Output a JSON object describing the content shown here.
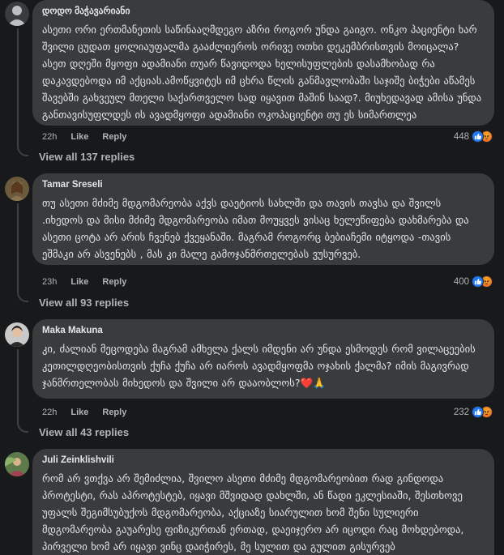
{
  "comments": [
    {
      "author": "დოდო მაჭავარიანი",
      "text": "ასეთი ორი ერთმანეთის საწინააღმდეგო აზრი როგორ უნდა გაიგო. ონკო პაციენტი ხარ შვილი ცუდათ ყოლიაუფალმა გააძლიეროს ორივე ოთხი დეკემბრისთვის მოიცალა? ასეთ დღეში მყოფი ადამიანი თუარ წავიდოდა ხელისუფლების დასამხობად რა დაკავდებოდა იმ აქციას.ამოწყვიტეს იმ ცხრა წლის განმავლობაში საჯიშე ბიჭები აწამეს შავებში გახვეულ მთელი საქართველო სად იყავით მაშინ საად?. მიუხედავად ამისა უნდა განთავისუფლდეს ის ავადმყოფი ადამიანი ოკოპაციენტი თუ ეს სიმართლეა",
      "time": "22h",
      "like": "Like",
      "reply": "Reply",
      "reaction_count": "448",
      "view_replies": "View all 137 replies"
    },
    {
      "author": "Tamar Sreseli",
      "text": "თუ ასეთი მძიმე მდგომარეობა აქვს დაეტიოს სახლში და თავის თავსა და შვილს .იხედოს და მისი მძიმე მდგომარეობა იმათ მოუყვეს ვისაც ხელეწიფება დახმარება და ასეთი ცოტა არ არის ჩვენებ ქვეყანაში. მაგრამ როგორც ბებიაჩემი იტყოდა -თავის ეშმაკი არ ასვენებს , მას კი მალე გამოჯანმრთელებას ვუსურვებ.",
      "time": "23h",
      "like": "Like",
      "reply": "Reply",
      "reaction_count": "400",
      "view_replies": "View all 93 replies"
    },
    {
      "author": "Maka Makuna",
      "text": "კი, ძალიან მეცოდება მაგრამ ამხელა ქალს იმდენი არ უნდა ესმოდეს რომ ვილაცეების კეთილდღეობისთვის ქუჩა ქუჩა არ იაროს ავადმყოფმა ოჯახის ქალმა? იმის მაგივრად ჯანმრთელობას მიხედოს და შვილი არ დააობლოს?",
      "emoji": "❤️🙏",
      "time": "22h",
      "like": "Like",
      "reply": "Reply",
      "reaction_count": "232",
      "view_replies": "View all 43 replies"
    },
    {
      "author": "Juli Zeinklishvili",
      "text": "რომ არ ვთქვა არ შემიძლია, შვილო ასეთი მძიმე მდგომარეობით რად გინდოდა პროტესტი, რას აპროტესტებ, იყავი მშვიდად დახლში, ან წადი ეკლესიაში, შესთხოვე უფალს შეგიმსუბუქოს მდგომარეობა, აქციაზე სიარულით ხომ შენი სულიერი მდგომარეობა გაუარესე ფიზიკურთან ერთად, დაეიჯერო არ იცოდი რაც მოხდებოდა, პირველი ხომ არ იყავი ვინც დაიჭირეს, მე სულით და გულით გისურვებ გამოჯანმრთელებას ❤️"
    }
  ],
  "colors": {
    "bg": "#18191a",
    "bubble": "#3a3b3c",
    "like": "#2078f4",
    "muted": "#b0b3b8"
  },
  "icons": [
    "like-reaction-icon",
    "angry-reaction-icon"
  ]
}
